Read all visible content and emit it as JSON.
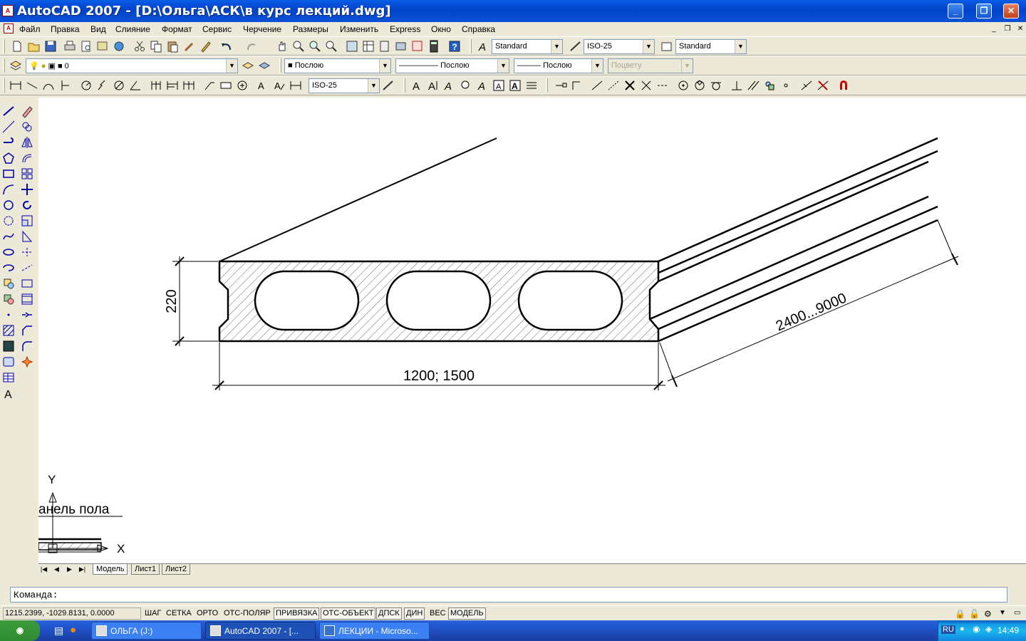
{
  "window": {
    "title": "AutoCAD 2007 - [D:\\Ольга\\АСК\\в курс лекций.dwg]",
    "minimize": "_",
    "maximize": "❐",
    "close": "✕"
  },
  "menu": [
    "Файл",
    "Правка",
    "Вид",
    "Слияние",
    "Формат",
    "Сервис",
    "Черчение",
    "Размеры",
    "Изменить",
    "Express",
    "Окно",
    "Справка"
  ],
  "toolbar_styles": {
    "text_style": "Standard",
    "dim_style": "ISO-25",
    "table_style": "Standard"
  },
  "toolbar_layers": {
    "layer": "0",
    "color": "Послою",
    "linetype": "Послою",
    "lineweight": "Послою",
    "plotstyle": "Поцвету"
  },
  "toolbar_dim": {
    "dim_style": "ISO-25"
  },
  "drawing": {
    "dim_height": "220",
    "dim_width": "1200; 1500",
    "dim_length": "2400...9000",
    "partial_label": "анель пола",
    "ucs_y": "Y",
    "ucs_x": "X"
  },
  "layout_tabs": [
    "Модель",
    "Лист1",
    "Лист2"
  ],
  "command": {
    "prompt": "Команда:"
  },
  "status": {
    "coords": "1215.2399, -1029.8131, 0.0000",
    "buttons": [
      "ШАГ",
      "СЕТКА",
      "ОРТО",
      "ОТС-ПОЛЯР",
      "ПРИВЯЗКА",
      "ОТС-ОБЪЕКТ",
      "ДПСК",
      "ДИН",
      "ВЕС",
      "МОДЕЛЬ"
    ]
  },
  "taskbar": {
    "tasks": [
      "ОЛЬГА (J:)",
      "AutoCAD 2007 - [...",
      "ЛЕКЦИИ - Microso..."
    ],
    "lang": "RU",
    "clock": "14:49"
  }
}
